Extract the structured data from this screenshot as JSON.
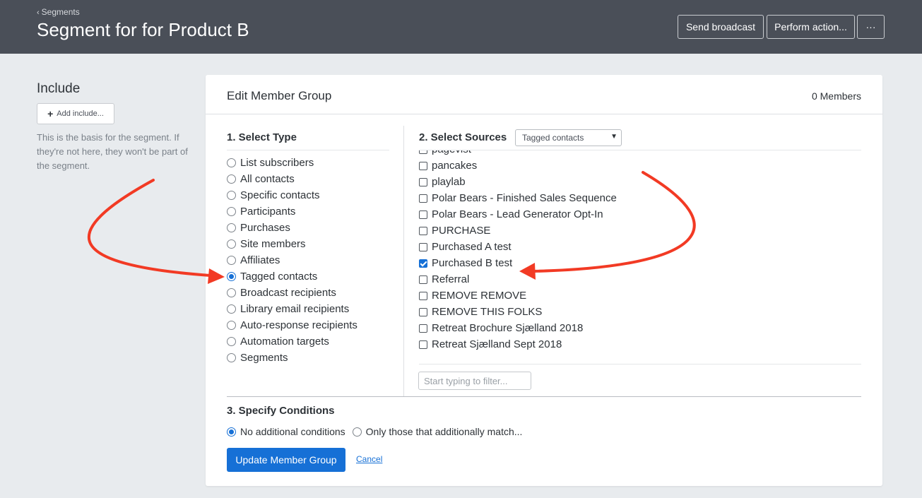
{
  "header": {
    "breadcrumb": "Segments",
    "title": "Segment for for Product B",
    "buttons": {
      "send_broadcast": "Send broadcast",
      "perform_action": "Perform action...",
      "more": "···"
    }
  },
  "include": {
    "title": "Include",
    "add_button": "Add include...",
    "help": "This is the basis for the segment. If they're not here, they won't be part of the segment."
  },
  "card": {
    "title": "Edit Member Group",
    "member_count": "0 Members",
    "section1": {
      "title": "1. Select Type",
      "options": [
        {
          "label": "List subscribers",
          "selected": false
        },
        {
          "label": "All contacts",
          "selected": false
        },
        {
          "label": "Specific contacts",
          "selected": false
        },
        {
          "label": "Participants",
          "selected": false
        },
        {
          "label": "Purchases",
          "selected": false
        },
        {
          "label": "Site members",
          "selected": false
        },
        {
          "label": "Affiliates",
          "selected": false
        },
        {
          "label": "Tagged contacts",
          "selected": true
        },
        {
          "label": "Broadcast recipients",
          "selected": false
        },
        {
          "label": "Library email recipients",
          "selected": false
        },
        {
          "label": "Auto-response recipients",
          "selected": false
        },
        {
          "label": "Automation targets",
          "selected": false
        },
        {
          "label": "Segments",
          "selected": false
        }
      ]
    },
    "section2": {
      "title": "2. Select Sources",
      "select_value": "Tagged contacts",
      "sources": [
        {
          "label": "pagevist",
          "checked": false
        },
        {
          "label": "pancakes",
          "checked": false
        },
        {
          "label": "playlab",
          "checked": false
        },
        {
          "label": "Polar Bears - Finished Sales Sequence",
          "checked": false
        },
        {
          "label": "Polar Bears - Lead Generator Opt-In",
          "checked": false
        },
        {
          "label": "PURCHASE",
          "checked": false
        },
        {
          "label": "Purchased A test",
          "checked": false
        },
        {
          "label": "Purchased B test",
          "checked": true
        },
        {
          "label": "Referral",
          "checked": false
        },
        {
          "label": "REMOVE REMOVE",
          "checked": false
        },
        {
          "label": "REMOVE THIS FOLKS",
          "checked": false
        },
        {
          "label": "Retreat Brochure Sjælland 2018",
          "checked": false
        },
        {
          "label": "Retreat Sjælland Sept 2018",
          "checked": false
        }
      ],
      "filter_placeholder": "Start typing to filter..."
    },
    "section3": {
      "title": "3. Specify Conditions",
      "options": [
        {
          "label": "No additional conditions",
          "selected": true
        },
        {
          "label": "Only those that additionally match...",
          "selected": false
        }
      ]
    },
    "update_button": "Update Member Group",
    "cancel_link": "Cancel"
  },
  "colors": {
    "header_bg": "#4a4f58",
    "accent": "#1670d6",
    "annotation_arrow": "#f23a24",
    "page_bg": "#e8ebee"
  }
}
